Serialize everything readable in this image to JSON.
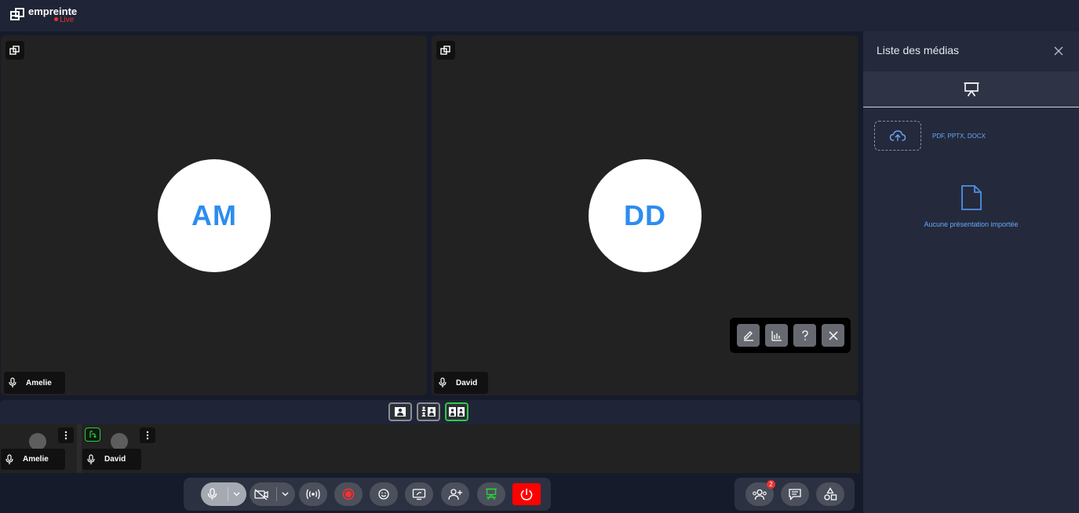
{
  "app": {
    "logo_name": "empreinte",
    "logo_live": "Live",
    "brand_red": "#e8322e",
    "accent_blue": "#2d8cf0",
    "active_green": "#2ecc40"
  },
  "stage": {
    "participants": [
      {
        "name": "Amelie",
        "initials": "AM"
      },
      {
        "name": "David",
        "initials": "DD"
      }
    ],
    "floating_toolbar": [
      "pencil-icon",
      "bar-chart-icon",
      "question-icon",
      "close-icon"
    ]
  },
  "layout_switcher": {
    "options": [
      "single-speaker",
      "grid",
      "side-by-side"
    ],
    "active": "side-by-side"
  },
  "filmstrip": {
    "participants": [
      {
        "name": "Amelie"
      },
      {
        "name": "David"
      }
    ]
  },
  "controls": {
    "buttons": [
      "microphone",
      "camera",
      "broadcast",
      "record",
      "reactions",
      "share-screen",
      "invite-participant",
      "presentation",
      "leave"
    ],
    "participants_count": "2"
  },
  "media_panel": {
    "title": "Liste des médias",
    "accepted_types": "PDF, PPTX, DOCX",
    "empty_message": "Aucune présentation importée"
  }
}
